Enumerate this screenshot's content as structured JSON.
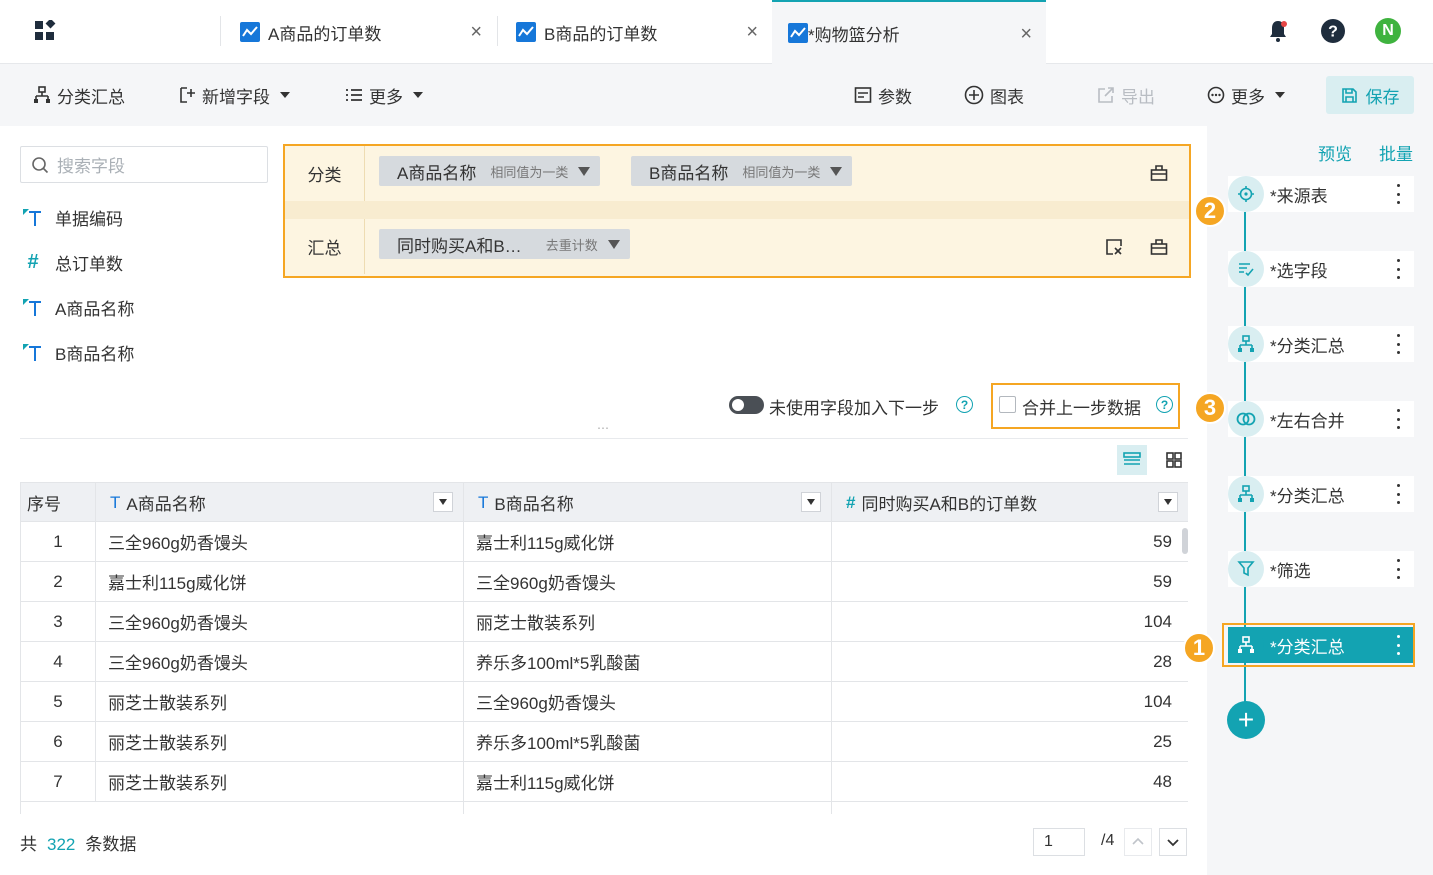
{
  "tabs": [
    {
      "label": "A商品的订单数",
      "close": "×"
    },
    {
      "label": "B商品的订单数",
      "close": "×"
    },
    {
      "label": "*购物篮分析",
      "close": "×"
    }
  ],
  "user_avatar": "N",
  "toolbar": {
    "group_summary": "分类汇总",
    "add_field": "新增字段",
    "more_left": "更多",
    "params": "参数",
    "chart": "图表",
    "export": "导出",
    "more_right": "更多",
    "save": "保存"
  },
  "search": {
    "placeholder": "搜索字段"
  },
  "fields": [
    {
      "label": "单据编码",
      "type": "text"
    },
    {
      "label": "总订单数",
      "type": "number"
    },
    {
      "label": "A商品名称",
      "type": "text"
    },
    {
      "label": "B商品名称",
      "type": "text"
    }
  ],
  "config": {
    "group_label": "分类",
    "summary_label": "汇总",
    "group_chips": [
      {
        "name": "A商品名称",
        "mode": "相同值为一类"
      },
      {
        "name": "B商品名称",
        "mode": "相同值为一类"
      }
    ],
    "summary_chips": [
      {
        "name": "同时购买A和B…",
        "mode": "去重计数"
      }
    ]
  },
  "options": {
    "unused_fields": "未使用字段加入下一步",
    "merge_prev": "合并上一步数据",
    "help": "?"
  },
  "handle": "⋯",
  "table": {
    "columns": [
      "序号",
      "A商品名称",
      "B商品名称",
      "同时购买A和B的订单数"
    ],
    "rows": [
      [
        "1",
        "三全960g奶香馒头",
        "嘉士利115g威化饼",
        "59"
      ],
      [
        "2",
        "嘉士利115g威化饼",
        "三全960g奶香馒头",
        "59"
      ],
      [
        "3",
        "三全960g奶香馒头",
        "丽芝士散装系列",
        "104"
      ],
      [
        "4",
        "三全960g奶香馒头",
        "养乐多100ml*5乳酸菌",
        "28"
      ],
      [
        "5",
        "丽芝士散装系列",
        "三全960g奶香馒头",
        "104"
      ],
      [
        "6",
        "丽芝士散装系列",
        "养乐多100ml*5乳酸菌",
        "25"
      ],
      [
        "7",
        "丽芝士散装系列",
        "嘉士利115g威化饼",
        "48"
      ]
    ]
  },
  "footer": {
    "prefix": "共",
    "count": "322",
    "suffix": "条数据",
    "page": "1",
    "total_pages": "/4"
  },
  "right_panel": {
    "preview": "预览",
    "batch": "批量",
    "steps": [
      {
        "label": "*来源表",
        "icon": "source-icon"
      },
      {
        "label": "*选字段",
        "icon": "select-fields-icon"
      },
      {
        "label": "*分类汇总",
        "icon": "group-summary-icon"
      },
      {
        "label": "*左右合并",
        "icon": "join-icon"
      },
      {
        "label": "*分类汇总",
        "icon": "group-summary-icon"
      },
      {
        "label": "*筛选",
        "icon": "filter-icon"
      },
      {
        "label": "*分类汇总",
        "icon": "group-summary-icon",
        "active": true
      }
    ],
    "add": "+"
  },
  "badges": [
    "1",
    "2",
    "3"
  ],
  "colors": {
    "accent": "#13a3b2",
    "highlight": "#f5a623"
  }
}
